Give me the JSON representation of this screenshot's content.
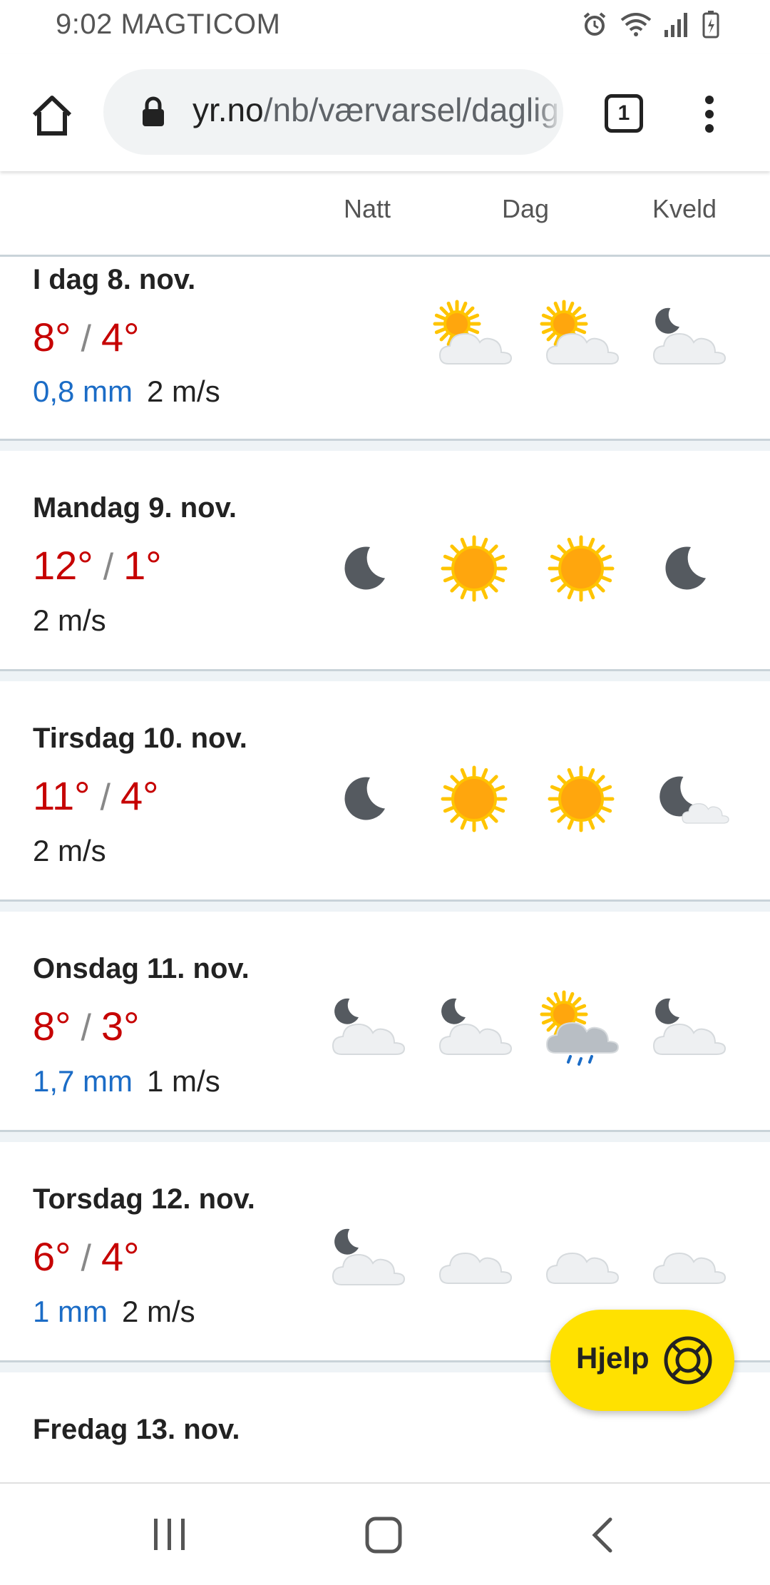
{
  "status_bar": {
    "time": "9:02",
    "carrier": "MAGTICOM"
  },
  "browser": {
    "url_domain": "yr.no",
    "url_path": "/nb/værvarsel/daglig",
    "tab_count": "1",
    "icons": [
      "home-icon",
      "lock-icon",
      "tab-switcher-icon",
      "overflow-menu-icon"
    ]
  },
  "columns": [
    "Natt",
    "Dag",
    "Kveld"
  ],
  "days": [
    {
      "title": "I dag 8. nov.",
      "high": "8°",
      "low": "4°",
      "precip": "0,8 mm",
      "wind": "2 m/s",
      "icons": [
        null,
        "sun-cloud",
        "sun-cloud",
        "moon-cloud"
      ]
    },
    {
      "title": "Mandag 9. nov.",
      "high": "12°",
      "low": "1°",
      "precip": "",
      "wind": "2 m/s",
      "icons": [
        "moon",
        "sun",
        "sun",
        "moon"
      ]
    },
    {
      "title": "Tirsdag 10. nov.",
      "high": "11°",
      "low": "4°",
      "precip": "",
      "wind": "2 m/s",
      "icons": [
        "moon",
        "sun",
        "sun",
        "moon-small-cloud"
      ]
    },
    {
      "title": "Onsdag 11. nov.",
      "high": "8°",
      "low": "3°",
      "precip": "1,7 mm",
      "wind": "1 m/s",
      "icons": [
        "moon-cloud",
        "moon-cloud",
        "sun-rain-cloud",
        "moon-cloud"
      ]
    },
    {
      "title": "Torsdag 12. nov.",
      "high": "6°",
      "low": "4°",
      "precip": "1 mm",
      "wind": "2 m/s",
      "icons": [
        "moon-cloud",
        "cloud",
        "cloud",
        "cloud"
      ]
    },
    {
      "title": "Fredag 13. nov.",
      "high": "",
      "low": "",
      "precip": "",
      "wind": "",
      "icons": []
    }
  ],
  "help_button": {
    "label": "Hjelp",
    "icon": "lifebuoy-icon"
  },
  "nav_bar": {
    "icons": [
      "recent-apps-icon",
      "home-nav-icon",
      "back-icon"
    ]
  },
  "colors": {
    "temp": "#c60000",
    "precip": "#1b6cc6",
    "help": "#ffe100",
    "divider": "#c9d3d9"
  }
}
